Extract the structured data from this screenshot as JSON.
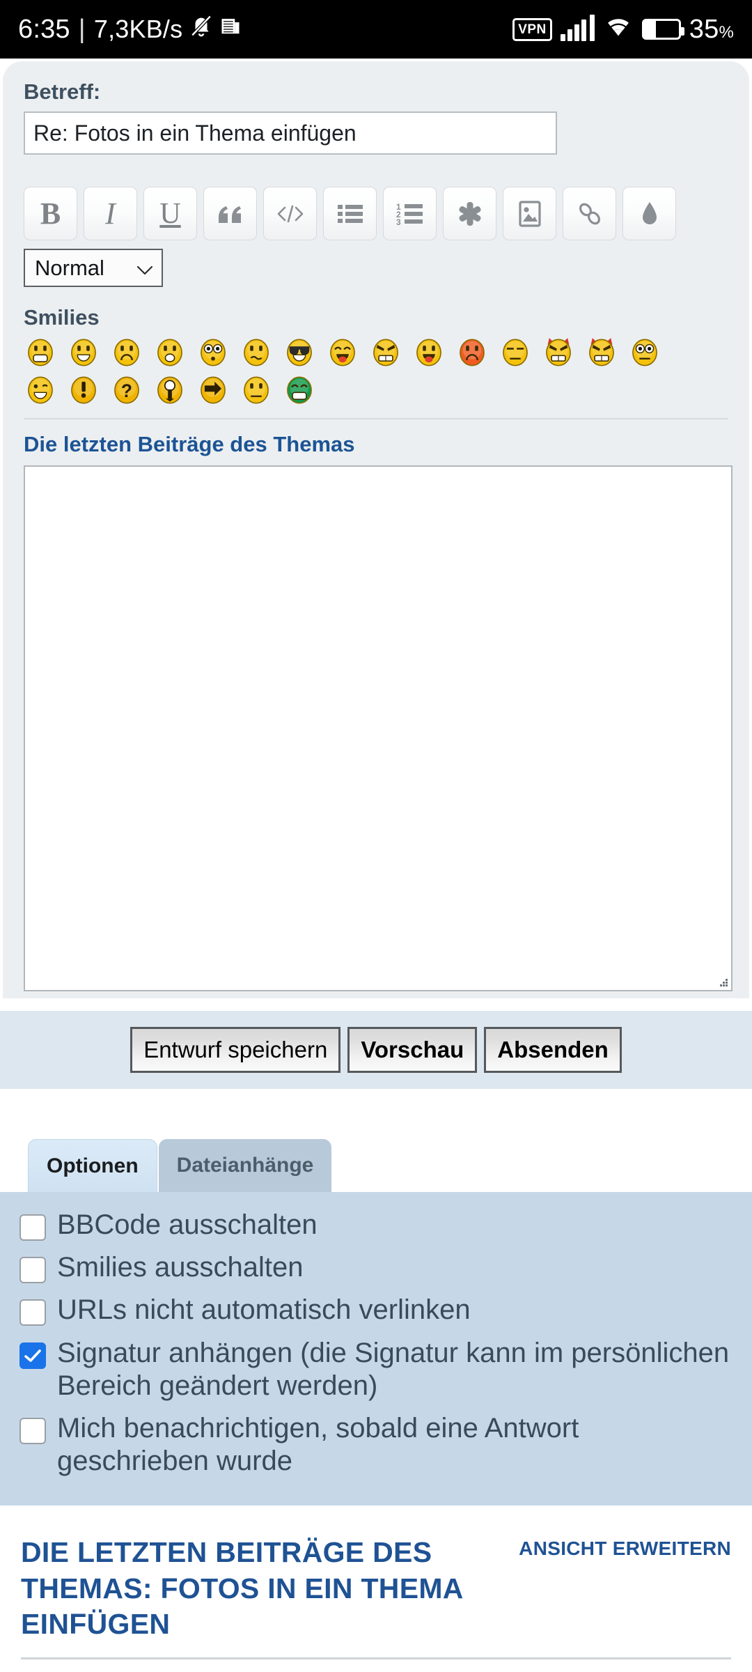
{
  "statusbar": {
    "time": "6:35",
    "separator": "|",
    "net_rate": "7,3KB/s",
    "icons_left": [
      "mute-bell-icon",
      "newspaper-icon"
    ],
    "vpn_label": "VPN",
    "icons_right": [
      "signal-icon",
      "wifi-icon",
      "battery-icon"
    ],
    "battery_percent": "35",
    "battery_percent_symbol": "%",
    "battery_fill_ratio": 0.35
  },
  "compose": {
    "subject_label": "Betreff:",
    "subject_value": "Re: Fotos in ein Thema einfügen",
    "subject_placeholder": "Betreff",
    "toolbar": [
      {
        "name": "bold-icon",
        "label": "B"
      },
      {
        "name": "italic-icon",
        "label": "I"
      },
      {
        "name": "underline-icon",
        "label": "U"
      },
      {
        "name": "quote-icon",
        "label": "“"
      },
      {
        "name": "code-icon",
        "label": "</>"
      },
      {
        "name": "bullet-list-icon",
        "label": "list"
      },
      {
        "name": "numbered-list-icon",
        "label": "123"
      },
      {
        "name": "asterisk-icon",
        "label": "*"
      },
      {
        "name": "image-icon",
        "label": "img"
      },
      {
        "name": "link-icon",
        "label": "link"
      },
      {
        "name": "color-droplet-icon",
        "label": "drop"
      }
    ],
    "format_select": {
      "value": "Normal",
      "options": [
        "Normal"
      ]
    },
    "smilies_label": "Smilies",
    "smilies_row1": [
      "grin-smiley",
      "happy-smiley",
      "sad-smiley",
      "surprised-smiley",
      "shocked-smiley",
      "confused-smiley",
      "cool-smiley",
      "laugh-smiley",
      "mad-smiley",
      "razz-smiley",
      "redface-smiley",
      "rolleyes-smiley",
      "evil-smiley",
      "twisted-smiley",
      "eek-smiley"
    ],
    "smilies_row2": [
      "wink-smiley",
      "exclaim-smiley",
      "question-smiley",
      "idea-smiley",
      "arrow-smiley",
      "neutral-smiley",
      "mrgreen-smiley"
    ],
    "posts_section_title": "Die letzten Beiträge des Themas",
    "message_value": "",
    "message_placeholder": ""
  },
  "actions": {
    "save_draft": "Entwurf speichern",
    "preview": "Vorschau",
    "submit": "Absenden"
  },
  "tabs": [
    {
      "label": "Optionen",
      "active": true
    },
    {
      "label": "Dateianhänge",
      "active": false
    }
  ],
  "options": [
    {
      "label": "BBCode ausschalten",
      "checked": false
    },
    {
      "label": "Smilies ausschalten",
      "checked": false
    },
    {
      "label": "URLs nicht automatisch verlinken",
      "checked": false
    },
    {
      "label": "Signatur anhängen (die Signatur kann im persönlichen Bereich geändert werden)",
      "checked": true
    },
    {
      "label": "Mich benachrichtigen, sobald eine Antwort geschrieben wurde",
      "checked": false
    }
  ],
  "bottom": {
    "title": "DIE LETZTEN BEITRÄGE DES THEMAS: FOTOS IN EIN THEMA EINFÜGEN",
    "expand_link": "ANSICHT ERWEITERN"
  },
  "colors": {
    "accent_blue": "#1f5294",
    "heading_blue": "#1c5494",
    "card_bg": "#eceff1",
    "action_bar_bg": "#dde7ef",
    "options_bg": "#c6d8e8",
    "tab_active_bg": "#cfe2f2",
    "tab_inactive_bg": "#b8cada",
    "checkbox_checked": "#1a73e8"
  }
}
